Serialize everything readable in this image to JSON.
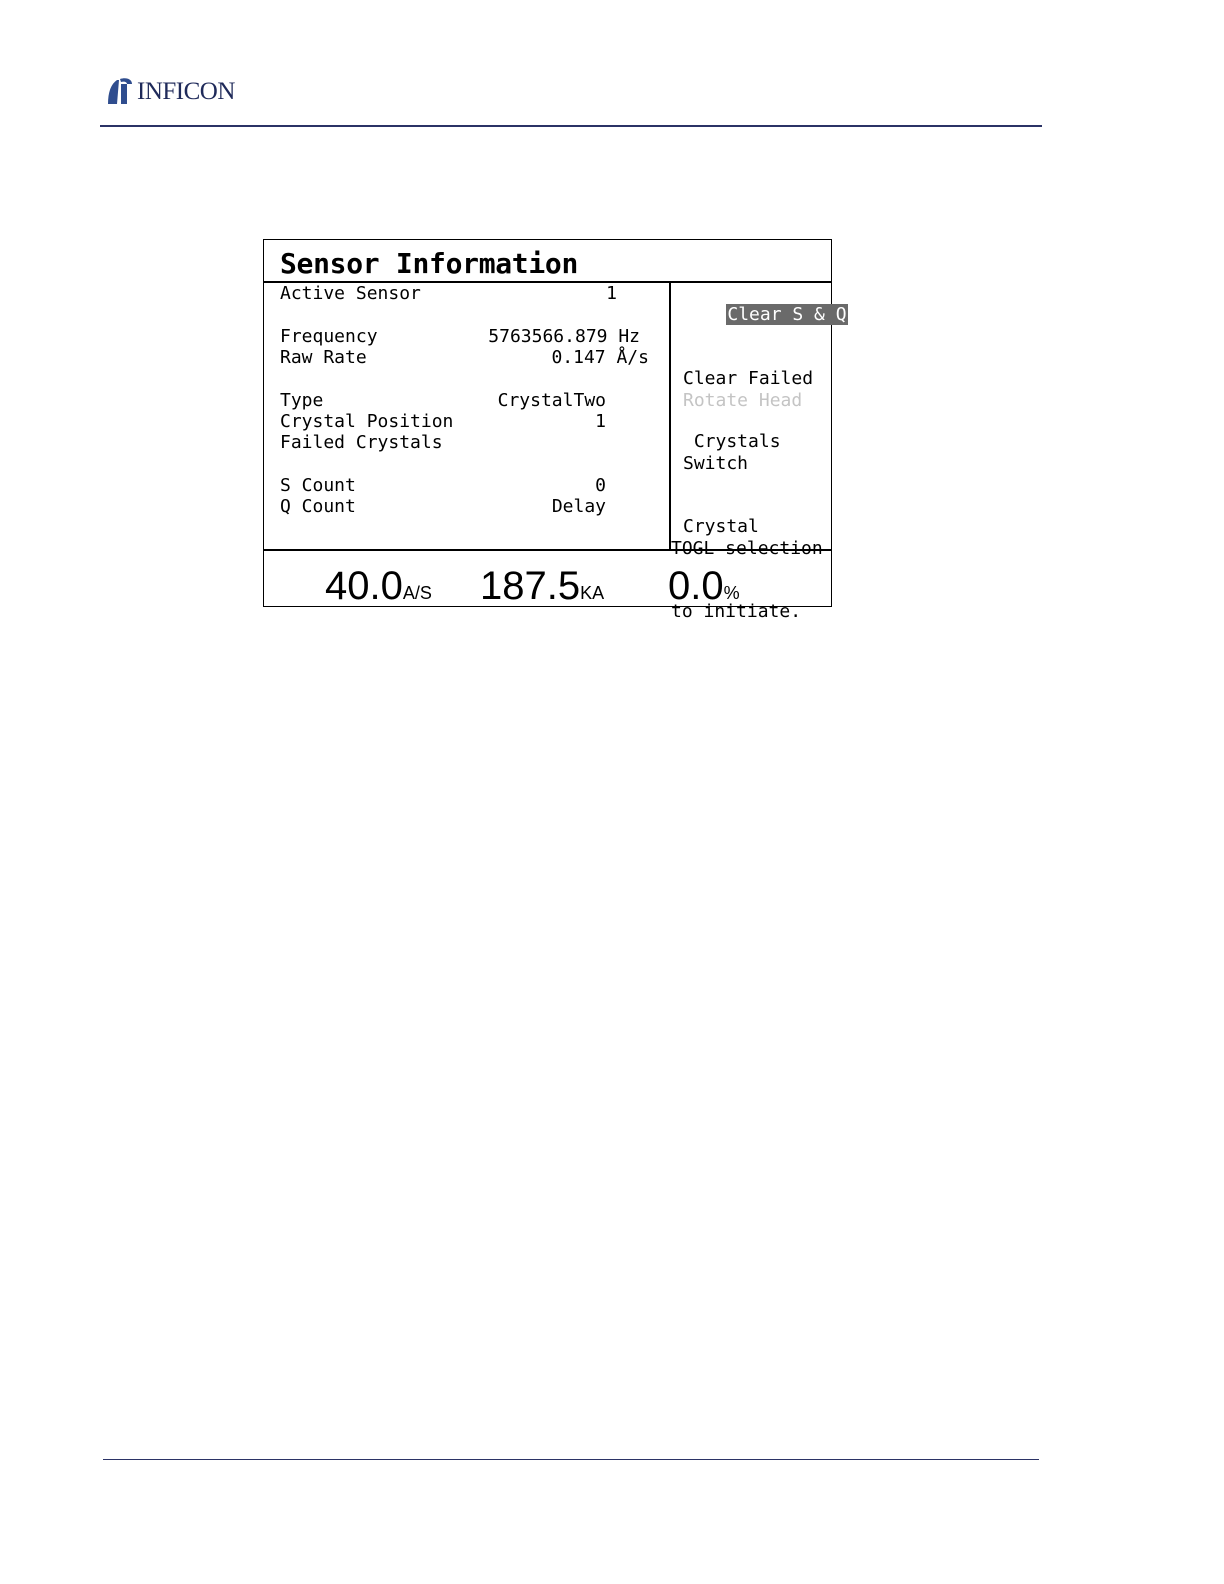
{
  "brand": {
    "name": "INFICON"
  },
  "screen": {
    "title": "Sensor Information",
    "fields": {
      "active_sensor": {
        "label": "Active Sensor",
        "value": "1"
      },
      "frequency": {
        "label": "Frequency",
        "value": "5763566.879 Hz"
      },
      "raw_rate": {
        "label": "Raw Rate",
        "value": "0.147 Å/s"
      },
      "type": {
        "label": "Type",
        "value": "CrystalTwo"
      },
      "crystal_position": {
        "label": "Crystal Position",
        "value": "1"
      },
      "failed_crystals": {
        "label": "Failed Crystals",
        "value": ""
      },
      "s_count": {
        "label": "S Count",
        "value": "0"
      },
      "q_count": {
        "label": "Q Count",
        "value": "Delay"
      }
    },
    "menu": {
      "clear_sq": "Clear S & Q",
      "clear_failed_1": "Clear Failed",
      "clear_failed_2": " Crystals",
      "rotate_head": "Rotate Head",
      "switch_crystal_1": "Switch",
      "switch_crystal_2": "Crystal",
      "hint_1": "TOGL selection",
      "hint_2": "to initiate."
    },
    "readouts": {
      "rate": {
        "value": "40.0",
        "unit": "A/S"
      },
      "thickness": {
        "value": "187.5",
        "unit": "KA"
      },
      "power": {
        "value": "0.0",
        "unit": "%"
      }
    }
  },
  "colors": {
    "brand": "#1f2a5a",
    "rule": "#2b3366",
    "selection_bg": "#6a6a6a",
    "disabled_text": "#c4c4c4"
  }
}
